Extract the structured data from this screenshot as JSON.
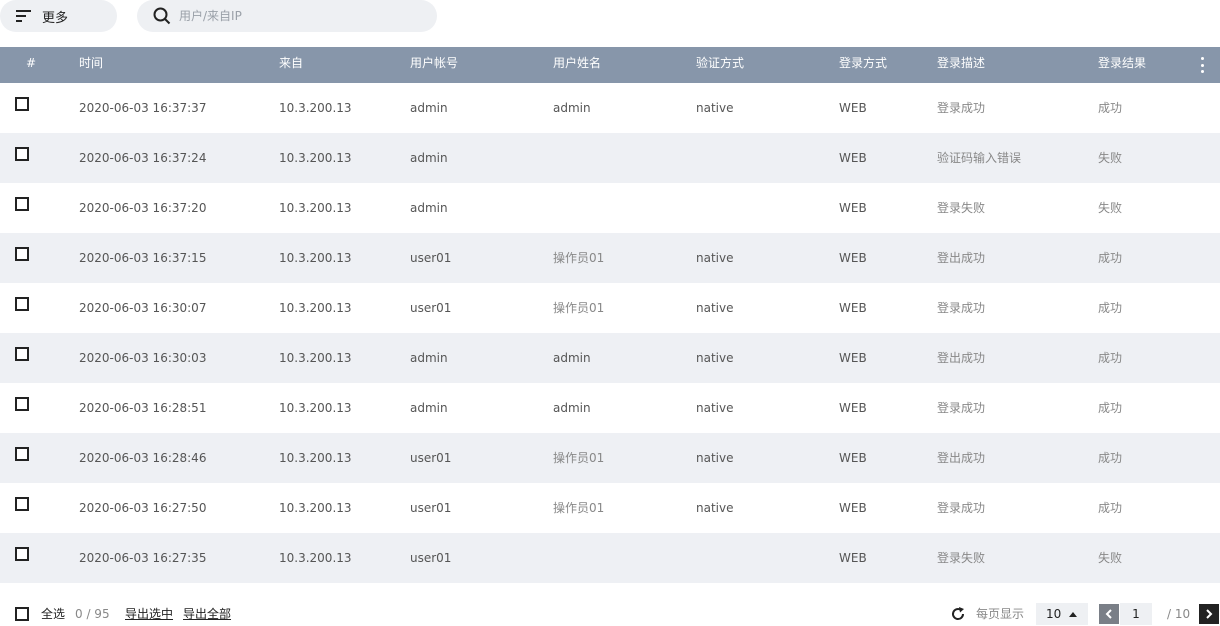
{
  "toolbar": {
    "more_label": "更多",
    "search_placeholder": "用户/来自IP",
    "search_value": ""
  },
  "table": {
    "columns": [
      "#",
      "时间",
      "来自",
      "用户帐号",
      "用户姓名",
      "验证方式",
      "登录方式",
      "登录描述",
      "登录结果"
    ],
    "rows": [
      [
        "2020-06-03 16:37:37",
        "10.3.200.13",
        "admin",
        "admin",
        "native",
        "WEB",
        "登录成功",
        "成功"
      ],
      [
        "2020-06-03 16:37:24",
        "10.3.200.13",
        "admin",
        "",
        "",
        "WEB",
        "验证码输入错误",
        "失败"
      ],
      [
        "2020-06-03 16:37:20",
        "10.3.200.13",
        "admin",
        "",
        "",
        "WEB",
        "登录失败",
        "失败"
      ],
      [
        "2020-06-03 16:37:15",
        "10.3.200.13",
        "user01",
        "操作员01",
        "native",
        "WEB",
        "登出成功",
        "成功"
      ],
      [
        "2020-06-03 16:30:07",
        "10.3.200.13",
        "user01",
        "操作员01",
        "native",
        "WEB",
        "登录成功",
        "成功"
      ],
      [
        "2020-06-03 16:30:03",
        "10.3.200.13",
        "admin",
        "admin",
        "native",
        "WEB",
        "登出成功",
        "成功"
      ],
      [
        "2020-06-03 16:28:51",
        "10.3.200.13",
        "admin",
        "admin",
        "native",
        "WEB",
        "登录成功",
        "成功"
      ],
      [
        "2020-06-03 16:28:46",
        "10.3.200.13",
        "user01",
        "操作员01",
        "native",
        "WEB",
        "登出成功",
        "成功"
      ],
      [
        "2020-06-03 16:27:50",
        "10.3.200.13",
        "user01",
        "操作员01",
        "native",
        "WEB",
        "登录成功",
        "成功"
      ],
      [
        "2020-06-03 16:27:35",
        "10.3.200.13",
        "user01",
        "",
        "",
        "WEB",
        "登录失败",
        "失败"
      ]
    ]
  },
  "footer": {
    "select_all_label": "全选",
    "selection_count": "0 / 95",
    "export_selected_label": "导出选中",
    "export_all_label": "导出全部",
    "per_page_label": "每页显示",
    "per_page_value": "10",
    "current_page": "1",
    "total_pages": "/ 10"
  },
  "icons": {
    "more": "filter-lines-icon",
    "search": "search-icon",
    "column_menu": "vertical-ellipsis-icon",
    "refresh": "refresh-icon",
    "per_page_caret": "caret-up-icon",
    "prev": "chevron-left-icon",
    "next": "chevron-right-icon"
  },
  "colors": {
    "header_bg": "#8796aa",
    "row_alt_bg": "#eef0f4",
    "control_bg": "#eef0f3"
  }
}
